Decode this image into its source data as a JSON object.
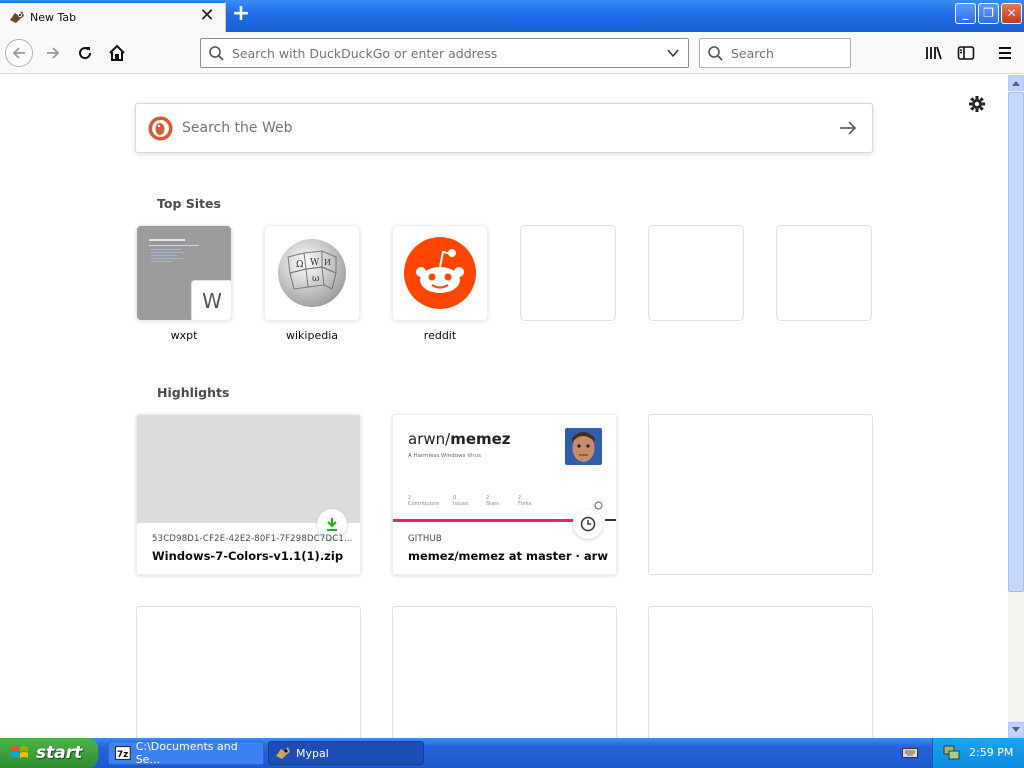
{
  "browser": {
    "tab_title": "New Tab",
    "close_tab_symbol": "✕",
    "new_tab_symbol": "+",
    "window_buttons": {
      "minimize": "_",
      "maximize": "❐",
      "close": "✕"
    },
    "urlbar_placeholder": "Search with DuckDuckGo or enter address",
    "searchbar_placeholder": "Search",
    "icons": [
      "back-icon",
      "forward-icon",
      "reload-icon",
      "home-icon",
      "search-icon",
      "dropdown-icon",
      "library-icon",
      "sidebar-icon",
      "menu-icon"
    ]
  },
  "newtab": {
    "search_placeholder": "Search the Web",
    "topsites_title": "Top Sites",
    "highlights_title": "Highlights",
    "topsites": [
      {
        "label": "wxpt",
        "badge": "W"
      },
      {
        "label": "wikipedia"
      },
      {
        "label": "reddit"
      }
    ],
    "highlights": [
      {
        "context": "53CD98D1-CF2E-42E2-80F1-7F298DC7DC1...",
        "title": "Windows-7-Colors-v1.1(1).zip"
      },
      {
        "context": "GITHUB",
        "title": "memez/memez at master · arw...",
        "repo_owner": "arwn/",
        "repo_name": "memez",
        "description": "A Harmless Windows Virus",
        "stats": [
          {
            "count": "2",
            "label": "Contributors"
          },
          {
            "count": "0",
            "label": "Issues"
          },
          {
            "count": "2",
            "label": "Stars"
          },
          {
            "count": "2",
            "label": "Forks"
          }
        ]
      }
    ]
  },
  "taskbar": {
    "start_label": "start",
    "tasks": [
      {
        "label": "C:\\Documents and Se..."
      },
      {
        "label": "Mypal"
      }
    ],
    "clock": "2:59 PM"
  },
  "colors": {
    "reddit": "#ff4500",
    "accent": "#0a84ff",
    "download_green": "#12bc00",
    "github_bar": "#e2286b",
    "xp_blue": "#2463d9",
    "start_green": "#3a9e3a"
  }
}
